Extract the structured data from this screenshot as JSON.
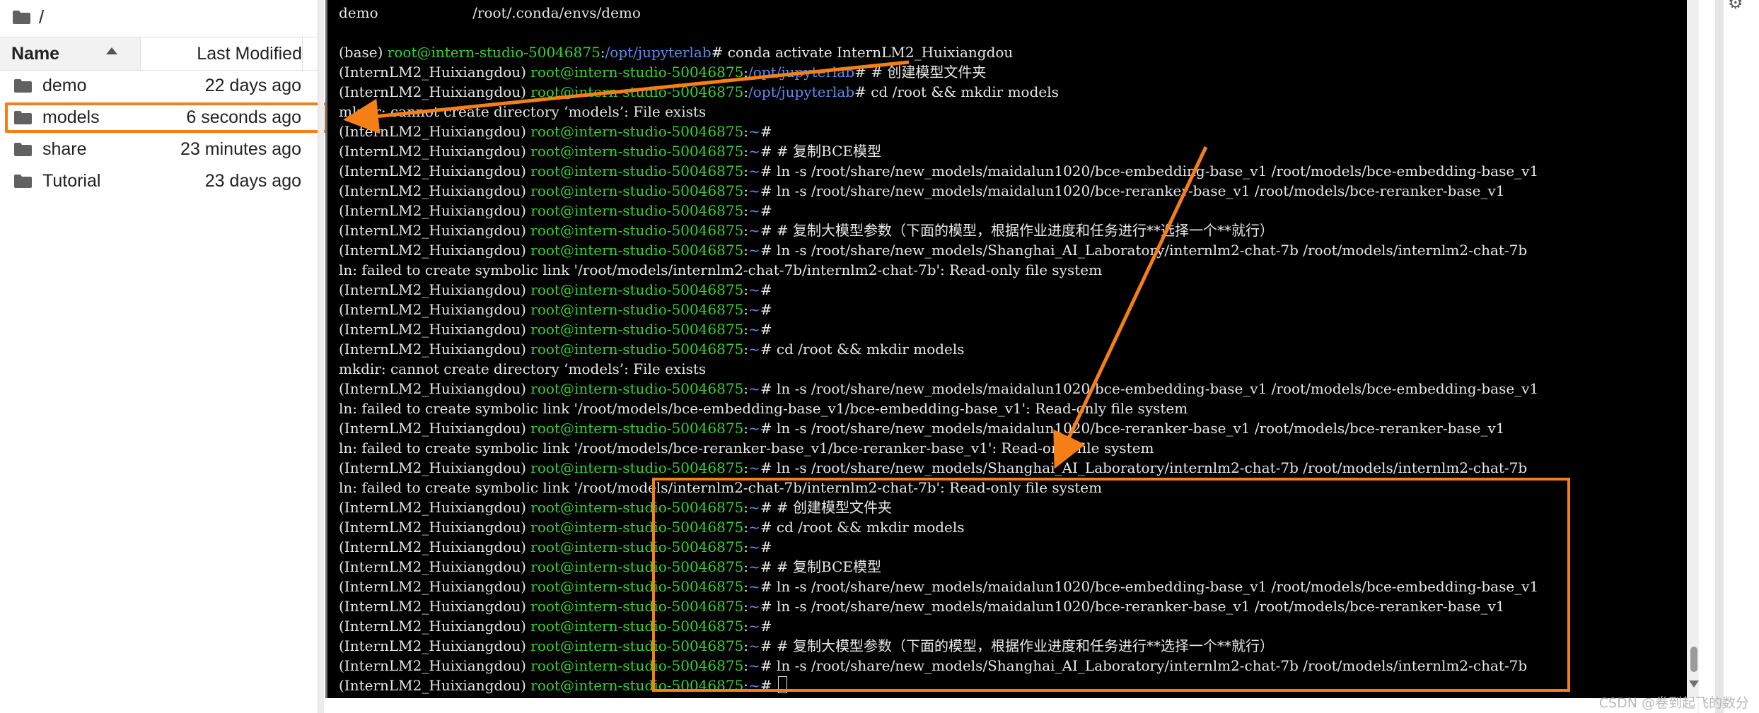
{
  "browser": {
    "path": "/",
    "header": {
      "name": "Name",
      "modified": "Last Modified"
    },
    "files": [
      {
        "name": "demo",
        "modified": "22 days ago"
      },
      {
        "name": "models",
        "modified": "6 seconds ago"
      },
      {
        "name": "share",
        "modified": "23 minutes ago"
      },
      {
        "name": "Tutorial",
        "modified": "23 days ago"
      }
    ]
  },
  "terminal": {
    "lines": [
      [
        {
          "t": "demo                     /root/.conda/envs/demo"
        }
      ],
      [
        {
          "t": ""
        }
      ],
      [
        {
          "t": "(base) "
        },
        {
          "t": "root@intern-studio-50046875",
          "c": "g"
        },
        {
          "t": ":"
        },
        {
          "t": "/opt/jupyterlab",
          "c": "b"
        },
        {
          "t": "# conda activate InternLM2_Huixiangdou"
        }
      ],
      [
        {
          "t": "(InternLM2_Huixiangdou) "
        },
        {
          "t": "root@intern-studio-50046875",
          "c": "g"
        },
        {
          "t": ":"
        },
        {
          "t": "/opt/jupyterlab",
          "c": "b"
        },
        {
          "t": "# # 创建模型文件夹"
        }
      ],
      [
        {
          "t": "(InternLM2_Huixiangdou) "
        },
        {
          "t": "root@intern-studio-50046875",
          "c": "g"
        },
        {
          "t": ":"
        },
        {
          "t": "/opt/jupyterlab",
          "c": "b"
        },
        {
          "t": "# cd /root && mkdir models"
        }
      ],
      [
        {
          "t": "mkdir: cannot create directory ‘models’: File exists"
        }
      ],
      [
        {
          "t": "(InternLM2_Huixiangdou) "
        },
        {
          "t": "root@intern-studio-50046875",
          "c": "g"
        },
        {
          "t": ":"
        },
        {
          "t": "~",
          "c": "b"
        },
        {
          "t": "#"
        }
      ],
      [
        {
          "t": "(InternLM2_Huixiangdou) "
        },
        {
          "t": "root@intern-studio-50046875",
          "c": "g"
        },
        {
          "t": ":"
        },
        {
          "t": "~",
          "c": "b"
        },
        {
          "t": "# # 复制BCE模型"
        }
      ],
      [
        {
          "t": "(InternLM2_Huixiangdou) "
        },
        {
          "t": "root@intern-studio-50046875",
          "c": "g"
        },
        {
          "t": ":"
        },
        {
          "t": "~",
          "c": "b"
        },
        {
          "t": "# ln -s /root/share/new_models/maidalun1020/bce-embedding-base_v1 /root/models/bce-embedding-base_v1"
        }
      ],
      [
        {
          "t": "(InternLM2_Huixiangdou) "
        },
        {
          "t": "root@intern-studio-50046875",
          "c": "g"
        },
        {
          "t": ":"
        },
        {
          "t": "~",
          "c": "b"
        },
        {
          "t": "# ln -s /root/share/new_models/maidalun1020/bce-reranker-base_v1 /root/models/bce-reranker-base_v1"
        }
      ],
      [
        {
          "t": "(InternLM2_Huixiangdou) "
        },
        {
          "t": "root@intern-studio-50046875",
          "c": "g"
        },
        {
          "t": ":"
        },
        {
          "t": "~",
          "c": "b"
        },
        {
          "t": "#"
        }
      ],
      [
        {
          "t": "(InternLM2_Huixiangdou) "
        },
        {
          "t": "root@intern-studio-50046875",
          "c": "g"
        },
        {
          "t": ":"
        },
        {
          "t": "~",
          "c": "b"
        },
        {
          "t": "# # 复制大模型参数（下面的模型，根据作业进度和任务进行**选择一个**就行）"
        }
      ],
      [
        {
          "t": "(InternLM2_Huixiangdou) "
        },
        {
          "t": "root@intern-studio-50046875",
          "c": "g"
        },
        {
          "t": ":"
        },
        {
          "t": "~",
          "c": "b"
        },
        {
          "t": "# ln -s /root/share/new_models/Shanghai_AI_Laboratory/internlm2-chat-7b /root/models/internlm2-chat-7b"
        }
      ],
      [
        {
          "t": "ln: failed to create symbolic link '/root/models/internlm2-chat-7b/internlm2-chat-7b': Read-only file system"
        }
      ],
      [
        {
          "t": "(InternLM2_Huixiangdou) "
        },
        {
          "t": "root@intern-studio-50046875",
          "c": "g"
        },
        {
          "t": ":"
        },
        {
          "t": "~",
          "c": "b"
        },
        {
          "t": "#"
        }
      ],
      [
        {
          "t": "(InternLM2_Huixiangdou) "
        },
        {
          "t": "root@intern-studio-50046875",
          "c": "g"
        },
        {
          "t": ":"
        },
        {
          "t": "~",
          "c": "b"
        },
        {
          "t": "#"
        }
      ],
      [
        {
          "t": "(InternLM2_Huixiangdou) "
        },
        {
          "t": "root@intern-studio-50046875",
          "c": "g"
        },
        {
          "t": ":"
        },
        {
          "t": "~",
          "c": "b"
        },
        {
          "t": "#"
        }
      ],
      [
        {
          "t": "(InternLM2_Huixiangdou) "
        },
        {
          "t": "root@intern-studio-50046875",
          "c": "g"
        },
        {
          "t": ":"
        },
        {
          "t": "~",
          "c": "b"
        },
        {
          "t": "# cd /root && mkdir models"
        }
      ],
      [
        {
          "t": "mkdir: cannot create directory ‘models’: File exists"
        }
      ],
      [
        {
          "t": "(InternLM2_Huixiangdou) "
        },
        {
          "t": "root@intern-studio-50046875",
          "c": "g"
        },
        {
          "t": ":"
        },
        {
          "t": "~",
          "c": "b"
        },
        {
          "t": "# ln -s /root/share/new_models/maidalun1020/bce-embedding-base_v1 /root/models/bce-embedding-base_v1"
        }
      ],
      [
        {
          "t": "ln: failed to create symbolic link '/root/models/bce-embedding-base_v1/bce-embedding-base_v1': Read-only file system"
        }
      ],
      [
        {
          "t": "(InternLM2_Huixiangdou) "
        },
        {
          "t": "root@intern-studio-50046875",
          "c": "g"
        },
        {
          "t": ":"
        },
        {
          "t": "~",
          "c": "b"
        },
        {
          "t": "# ln -s /root/share/new_models/maidalun1020/bce-reranker-base_v1 /root/models/bce-reranker-base_v1"
        }
      ],
      [
        {
          "t": "ln: failed to create symbolic link '/root/models/bce-reranker-base_v1/bce-reranker-base_v1': Read-only file system"
        }
      ],
      [
        {
          "t": "(InternLM2_Huixiangdou) "
        },
        {
          "t": "root@intern-studio-50046875",
          "c": "g"
        },
        {
          "t": ":"
        },
        {
          "t": "~",
          "c": "b"
        },
        {
          "t": "# ln -s /root/share/new_models/Shanghai_AI_Laboratory/internlm2-chat-7b /root/models/internlm2-chat-7b"
        }
      ],
      [
        {
          "t": "ln: failed to create symbolic link '/root/models/internlm2-chat-7b/internlm2-chat-7b': Read-only file system"
        }
      ],
      [
        {
          "t": "(InternLM2_Huixiangdou) "
        },
        {
          "t": "root@intern-studio-50046875",
          "c": "g"
        },
        {
          "t": ":"
        },
        {
          "t": "~",
          "c": "b"
        },
        {
          "t": "# # 创建模型文件夹"
        }
      ],
      [
        {
          "t": "(InternLM2_Huixiangdou) "
        },
        {
          "t": "root@intern-studio-50046875",
          "c": "g"
        },
        {
          "t": ":"
        },
        {
          "t": "~",
          "c": "b"
        },
        {
          "t": "# cd /root && mkdir models"
        }
      ],
      [
        {
          "t": "(InternLM2_Huixiangdou) "
        },
        {
          "t": "root@intern-studio-50046875",
          "c": "g"
        },
        {
          "t": ":"
        },
        {
          "t": "~",
          "c": "b"
        },
        {
          "t": "#"
        }
      ],
      [
        {
          "t": "(InternLM2_Huixiangdou) "
        },
        {
          "t": "root@intern-studio-50046875",
          "c": "g"
        },
        {
          "t": ":"
        },
        {
          "t": "~",
          "c": "b"
        },
        {
          "t": "# # 复制BCE模型"
        }
      ],
      [
        {
          "t": "(InternLM2_Huixiangdou) "
        },
        {
          "t": "root@intern-studio-50046875",
          "c": "g"
        },
        {
          "t": ":"
        },
        {
          "t": "~",
          "c": "b"
        },
        {
          "t": "# ln -s /root/share/new_models/maidalun1020/bce-embedding-base_v1 /root/models/bce-embedding-base_v1"
        }
      ],
      [
        {
          "t": "(InternLM2_Huixiangdou) "
        },
        {
          "t": "root@intern-studio-50046875",
          "c": "g"
        },
        {
          "t": ":"
        },
        {
          "t": "~",
          "c": "b"
        },
        {
          "t": "# ln -s /root/share/new_models/maidalun1020/bce-reranker-base_v1 /root/models/bce-reranker-base_v1"
        }
      ],
      [
        {
          "t": "(InternLM2_Huixiangdou) "
        },
        {
          "t": "root@intern-studio-50046875",
          "c": "g"
        },
        {
          "t": ":"
        },
        {
          "t": "~",
          "c": "b"
        },
        {
          "t": "#"
        }
      ],
      [
        {
          "t": "(InternLM2_Huixiangdou) "
        },
        {
          "t": "root@intern-studio-50046875",
          "c": "g"
        },
        {
          "t": ":"
        },
        {
          "t": "~",
          "c": "b"
        },
        {
          "t": "# # 复制大模型参数（下面的模型，根据作业进度和任务进行**选择一个**就行）"
        }
      ],
      [
        {
          "t": "(InternLM2_Huixiangdou) "
        },
        {
          "t": "root@intern-studio-50046875",
          "c": "g"
        },
        {
          "t": ":"
        },
        {
          "t": "~",
          "c": "b"
        },
        {
          "t": "# ln -s /root/share/new_models/Shanghai_AI_Laboratory/internlm2-chat-7b /root/models/internlm2-chat-7b"
        }
      ],
      [
        {
          "t": "(InternLM2_Huixiangdou) "
        },
        {
          "t": "root@intern-studio-50046875",
          "c": "g"
        },
        {
          "t": ":"
        },
        {
          "t": "~",
          "c": "b"
        },
        {
          "t": "# "
        }
      ]
    ]
  },
  "colors": {
    "annotation": "#f57f17",
    "prompt_user": "#34d52e",
    "prompt_path": "#5a8df0",
    "terminal_bg": "#000000"
  },
  "icons": [
    "folder-icon",
    "sort-ascending-icon",
    "gear-icon",
    "scroll-down-icon"
  ],
  "watermark": "CSDN @卷到起飞的数分"
}
